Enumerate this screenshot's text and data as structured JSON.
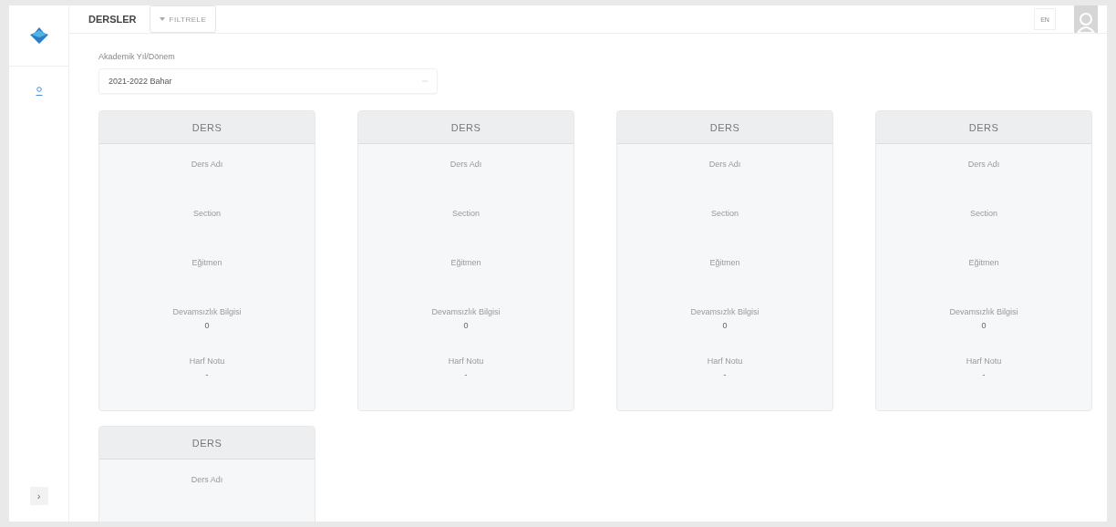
{
  "header": {
    "title": "DERSLER",
    "filter_button": "FILTRELE",
    "language": "EN"
  },
  "sidebar": {
    "expand_button": "›"
  },
  "term_select": {
    "label": "Akademik Yıl/Dönem",
    "value": "2021-2022 Bahar"
  },
  "cards": [
    {
      "title": "DERS",
      "fields": [
        {
          "label": "Ders Adı"
        },
        {
          "label": "Section"
        },
        {
          "label": "Eğitmen"
        },
        {
          "label": "Devamsızlık Bilgisi",
          "value": "0"
        },
        {
          "label": "Harf Notu",
          "value": "-"
        }
      ]
    },
    {
      "title": "DERS",
      "fields": [
        {
          "label": "Ders Adı"
        },
        {
          "label": "Section"
        },
        {
          "label": "Eğitmen"
        },
        {
          "label": "Devamsızlık Bilgisi",
          "value": "0"
        },
        {
          "label": "Harf Notu",
          "value": "-"
        }
      ]
    },
    {
      "title": "DERS",
      "fields": [
        {
          "label": "Ders Adı"
        },
        {
          "label": "Section"
        },
        {
          "label": "Eğitmen"
        },
        {
          "label": "Devamsızlık Bilgisi",
          "value": "0"
        },
        {
          "label": "Harf Notu",
          "value": "-"
        }
      ]
    },
    {
      "title": "DERS",
      "fields": [
        {
          "label": "Ders Adı"
        },
        {
          "label": "Section"
        },
        {
          "label": "Eğitmen"
        },
        {
          "label": "Devamsızlık Bilgisi",
          "value": "0"
        },
        {
          "label": "Harf Notu",
          "value": "-"
        }
      ]
    },
    {
      "title": "DERS",
      "fields": [
        {
          "label": "Ders Adı"
        }
      ]
    }
  ]
}
